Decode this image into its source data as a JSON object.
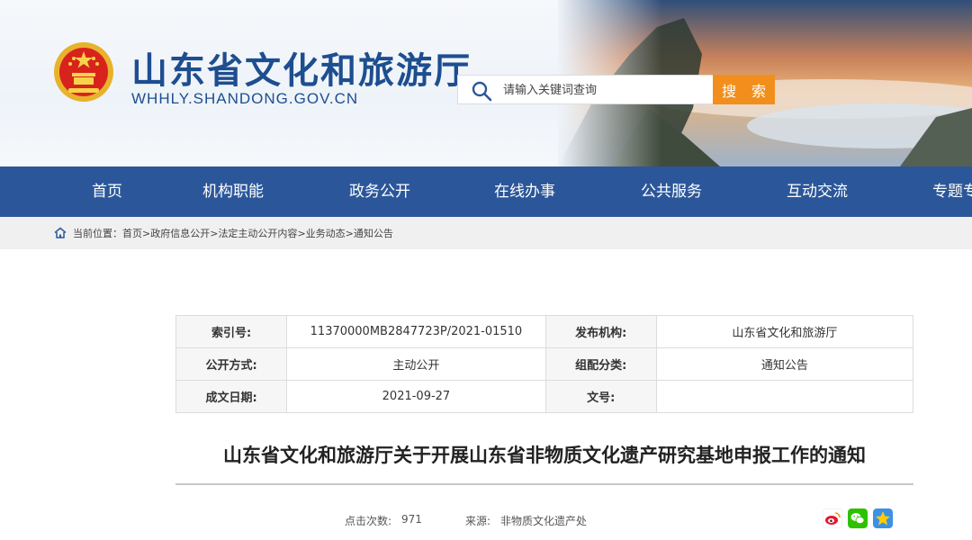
{
  "header": {
    "site_title": "山东省文化和旅游厅",
    "domain": "WHHLY.SHANDONG.GOV.CN",
    "emblem_icon": "national-emblem-icon"
  },
  "search": {
    "placeholder": "请输入关键词查询",
    "button_label": "搜 索",
    "button_color": "#f28f1c"
  },
  "nav": {
    "bg_color": "#2b579a",
    "items": [
      {
        "label": "首页"
      },
      {
        "label": "机构职能"
      },
      {
        "label": "政务公开"
      },
      {
        "label": "在线办事"
      },
      {
        "label": "公共服务"
      },
      {
        "label": "互动交流"
      },
      {
        "label": "专题专"
      }
    ]
  },
  "breadcrumb": {
    "prefix": "当前位置：",
    "items": [
      "首页",
      "政府信息公开",
      "法定主动公开内容",
      "业务动态",
      "通知公告"
    ],
    "separator": ">"
  },
  "info_table": {
    "rows": [
      {
        "k1": "索引号:",
        "v1": "11370000MB2847723P/2021-01510",
        "k2": "发布机构:",
        "v2": "山东省文化和旅游厅"
      },
      {
        "k1": "公开方式:",
        "v1": "主动公开",
        "k2": "组配分类:",
        "v2": "通知公告"
      },
      {
        "k1": "成文日期:",
        "v1": "2021-09-27",
        "k2": "文号:",
        "v2": ""
      }
    ]
  },
  "article": {
    "title": "山东省文化和旅游厅关于开展山东省非物质文化遗产研究基地申报工作的通知",
    "clicks_label": "点击次数:",
    "clicks_value": "971",
    "source_label": "来源:",
    "source_value": "非物质文化遗产处"
  },
  "share": {
    "icons": [
      "weibo-icon",
      "wechat-icon",
      "qzone-icon"
    ]
  }
}
